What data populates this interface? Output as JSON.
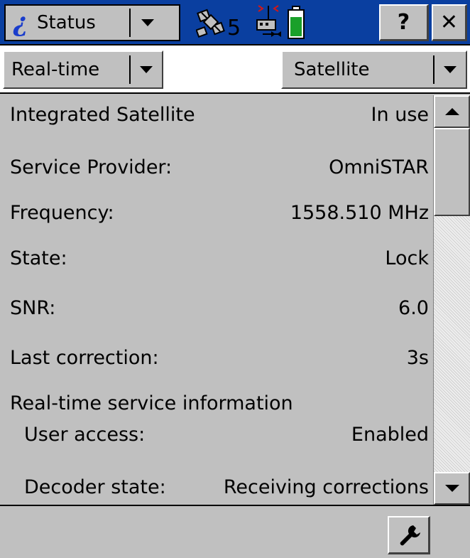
{
  "titlebar": {
    "app_label": "Status",
    "satellite_count": "5",
    "help_label": "?",
    "close_label": "✕"
  },
  "toolbar": {
    "mode_select": "Real-time",
    "view_select": "Satellite"
  },
  "details": [
    {
      "label": "Integrated Satellite",
      "value": "In use"
    },
    {
      "label": "Service Provider:",
      "value": "OmniSTAR"
    },
    {
      "label": "Frequency:",
      "value": "1558.510 MHz"
    },
    {
      "label": "State:",
      "value": "Lock"
    },
    {
      "label": "SNR:",
      "value": "6.0"
    },
    {
      "label": "Last correction:",
      "value": "3s"
    }
  ],
  "service_info": {
    "heading": "Real-time service information",
    "items": [
      {
        "label": "User access:",
        "value": "Enabled"
      },
      {
        "label": "Decoder state:",
        "value": "Receiving corrections"
      }
    ]
  },
  "icons": {
    "title_info": "info-icon",
    "satellites": "satellite-icon",
    "radio": "radio-antenna-icon",
    "battery": "battery-icon",
    "dropdown": "chevron-down-icon",
    "scroll_up": "arrow-up-icon",
    "scroll_down": "arrow-down-icon",
    "settings": "wrench-icon"
  },
  "colors": {
    "titlebar_bg": "#0a3fa0",
    "window_bg": "#c0c0c0",
    "battery_green": "#1aa02a"
  }
}
